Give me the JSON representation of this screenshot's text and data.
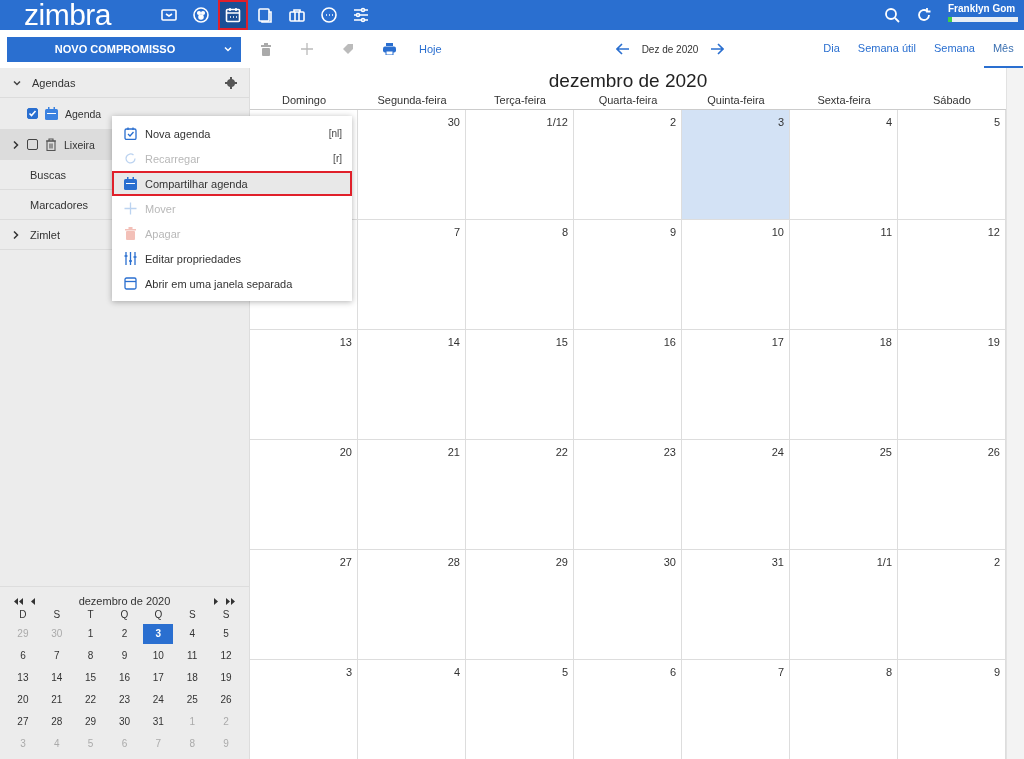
{
  "topbar": {
    "logo": "zimbra",
    "apps": [
      {
        "kind": "mail",
        "selected": false
      },
      {
        "kind": "contacts",
        "selected": false
      },
      {
        "kind": "calendar",
        "selected": true
      },
      {
        "kind": "tasks",
        "selected": false
      },
      {
        "kind": "briefcase",
        "selected": false
      },
      {
        "kind": "chat",
        "selected": false
      },
      {
        "kind": "prefs",
        "selected": false
      }
    ],
    "user": "Franklyn Gom",
    "quota": {
      "level": 0.05
    }
  },
  "toolbar": {
    "new_button": "NOVO COMPROMISSO",
    "today": "Hoje",
    "period": "Dez de 2020",
    "views": [
      {
        "label": "Dia",
        "selected": false
      },
      {
        "label": "Semana útil",
        "selected": false
      },
      {
        "label": "Semana",
        "selected": false
      },
      {
        "label": "Mês",
        "selected": true
      }
    ]
  },
  "sidebar": {
    "header": {
      "label": "Agendas",
      "expanded": true
    },
    "calendars": [
      {
        "kind": "calendar",
        "label": "Agenda",
        "checked": true,
        "selected": false
      },
      {
        "kind": "trash",
        "label": "Lixeira",
        "checked": false,
        "selected": true
      }
    ],
    "sections": [
      {
        "label": "Buscas",
        "expandable": false
      },
      {
        "label": "Marcadores",
        "expandable": false
      },
      {
        "label": "Zimlet",
        "expandable": true
      }
    ]
  },
  "context_menu": [
    {
      "kind": "new",
      "label": "Nova agenda",
      "shortcut": "[nl]",
      "disabled": false,
      "highlighted": false
    },
    {
      "kind": "reload",
      "label": "Recarregar",
      "shortcut": "[r]",
      "disabled": true,
      "highlighted": false
    },
    {
      "kind": "share",
      "label": "Compartilhar agenda",
      "disabled": false,
      "highlighted": true
    },
    {
      "kind": "move",
      "label": "Mover",
      "disabled": true,
      "highlighted": false
    },
    {
      "kind": "delete",
      "label": "Apagar",
      "disabled": true,
      "highlighted": false
    },
    {
      "kind": "props",
      "label": "Editar propriedades",
      "disabled": false,
      "highlighted": false
    },
    {
      "kind": "window",
      "label": "Abrir em uma janela separada",
      "disabled": false,
      "highlighted": false
    }
  ],
  "month_view": {
    "title": "dezembro de 2020",
    "weekdays": [
      "Domingo",
      "Segunda-feira",
      "Terça-feira",
      "Quarta-feira",
      "Quinta-feira",
      "Sexta-feira",
      "Sábado"
    ],
    "weeks": [
      [
        {
          "selected": false
        },
        {
          "day": "30",
          "selected": false
        },
        {
          "day": "1/12",
          "selected": false
        },
        {
          "day": "2",
          "selected": false
        },
        {
          "day": "3",
          "selected": true
        },
        {
          "day": "4",
          "selected": false
        },
        {
          "day": "5",
          "selected": false
        }
      ],
      [
        {
          "selected": false
        },
        {
          "day": "7",
          "selected": false
        },
        {
          "day": "8",
          "selected": false
        },
        {
          "day": "9",
          "selected": false
        },
        {
          "day": "10",
          "selected": false
        },
        {
          "day": "11",
          "selected": false
        },
        {
          "day": "12",
          "selected": false
        }
      ],
      [
        {
          "day": "13",
          "selected": false
        },
        {
          "day": "14",
          "selected": false
        },
        {
          "day": "15",
          "selected": false
        },
        {
          "day": "16",
          "selected": false
        },
        {
          "day": "17",
          "selected": false
        },
        {
          "day": "18",
          "selected": false
        },
        {
          "day": "19",
          "selected": false
        }
      ],
      [
        {
          "day": "20",
          "selected": false
        },
        {
          "day": "21",
          "selected": false
        },
        {
          "day": "22",
          "selected": false
        },
        {
          "day": "23",
          "selected": false
        },
        {
          "day": "24",
          "selected": false
        },
        {
          "day": "25",
          "selected": false
        },
        {
          "day": "26",
          "selected": false
        }
      ],
      [
        {
          "day": "27",
          "selected": false
        },
        {
          "day": "28",
          "selected": false
        },
        {
          "day": "29",
          "selected": false
        },
        {
          "day": "30",
          "selected": false
        },
        {
          "day": "31",
          "selected": false
        },
        {
          "day": "1/1",
          "selected": false
        },
        {
          "day": "2",
          "selected": false
        }
      ],
      [
        {
          "day": "3",
          "selected": false
        },
        {
          "day": "4",
          "selected": false
        },
        {
          "day": "5",
          "selected": false
        },
        {
          "day": "6",
          "selected": false
        },
        {
          "day": "7",
          "selected": false
        },
        {
          "day": "8",
          "selected": false
        },
        {
          "day": "9",
          "selected": false
        }
      ]
    ]
  },
  "mini_calendar": {
    "title": "dezembro de 2020",
    "weekdays": [
      "D",
      "S",
      "T",
      "Q",
      "Q",
      "S",
      "S"
    ],
    "weeks": [
      [
        {
          "day": "29",
          "other_month": true,
          "selected": false
        },
        {
          "day": "30",
          "other_month": true,
          "selected": false
        },
        {
          "day": "1",
          "other_month": false,
          "selected": false
        },
        {
          "day": "2",
          "other_month": false,
          "selected": false
        },
        {
          "day": "3",
          "other_month": false,
          "selected": true
        },
        {
          "day": "4",
          "other_month": false,
          "selected": false
        },
        {
          "day": "5",
          "other_month": false,
          "selected": false
        }
      ],
      [
        {
          "day": "6",
          "other_month": false,
          "selected": false
        },
        {
          "day": "7",
          "other_month": false,
          "selected": false
        },
        {
          "day": "8",
          "other_month": false,
          "selected": false
        },
        {
          "day": "9",
          "other_month": false,
          "selected": false
        },
        {
          "day": "10",
          "other_month": false,
          "selected": false
        },
        {
          "day": "11",
          "other_month": false,
          "selected": false
        },
        {
          "day": "12",
          "other_month": false,
          "selected": false
        }
      ],
      [
        {
          "day": "13",
          "other_month": false,
          "selected": false
        },
        {
          "day": "14",
          "other_month": false,
          "selected": false
        },
        {
          "day": "15",
          "other_month": false,
          "selected": false
        },
        {
          "day": "16",
          "other_month": false,
          "selected": false
        },
        {
          "day": "17",
          "other_month": false,
          "selected": false
        },
        {
          "day": "18",
          "other_month": false,
          "selected": false
        },
        {
          "day": "19",
          "other_month": false,
          "selected": false
        }
      ],
      [
        {
          "day": "20",
          "other_month": false,
          "selected": false
        },
        {
          "day": "21",
          "other_month": false,
          "selected": false
        },
        {
          "day": "22",
          "other_month": false,
          "selected": false
        },
        {
          "day": "23",
          "other_month": false,
          "selected": false
        },
        {
          "day": "24",
          "other_month": false,
          "selected": false
        },
        {
          "day": "25",
          "other_month": false,
          "selected": false
        },
        {
          "day": "26",
          "other_month": false,
          "selected": false
        }
      ],
      [
        {
          "day": "27",
          "other_month": false,
          "selected": false
        },
        {
          "day": "28",
          "other_month": false,
          "selected": false
        },
        {
          "day": "29",
          "other_month": false,
          "selected": false
        },
        {
          "day": "30",
          "other_month": false,
          "selected": false
        },
        {
          "day": "31",
          "other_month": false,
          "selected": false
        },
        {
          "day": "1",
          "other_month": true,
          "selected": false
        },
        {
          "day": "2",
          "other_month": true,
          "selected": false
        }
      ],
      [
        {
          "day": "3",
          "other_month": true,
          "selected": false
        },
        {
          "day": "4",
          "other_month": true,
          "selected": false
        },
        {
          "day": "5",
          "other_month": true,
          "selected": false
        },
        {
          "day": "6",
          "other_month": true,
          "selected": false
        },
        {
          "day": "7",
          "other_month": true,
          "selected": false
        },
        {
          "day": "8",
          "other_month": true,
          "selected": false
        },
        {
          "day": "9",
          "other_month": true,
          "selected": false
        }
      ]
    ]
  }
}
